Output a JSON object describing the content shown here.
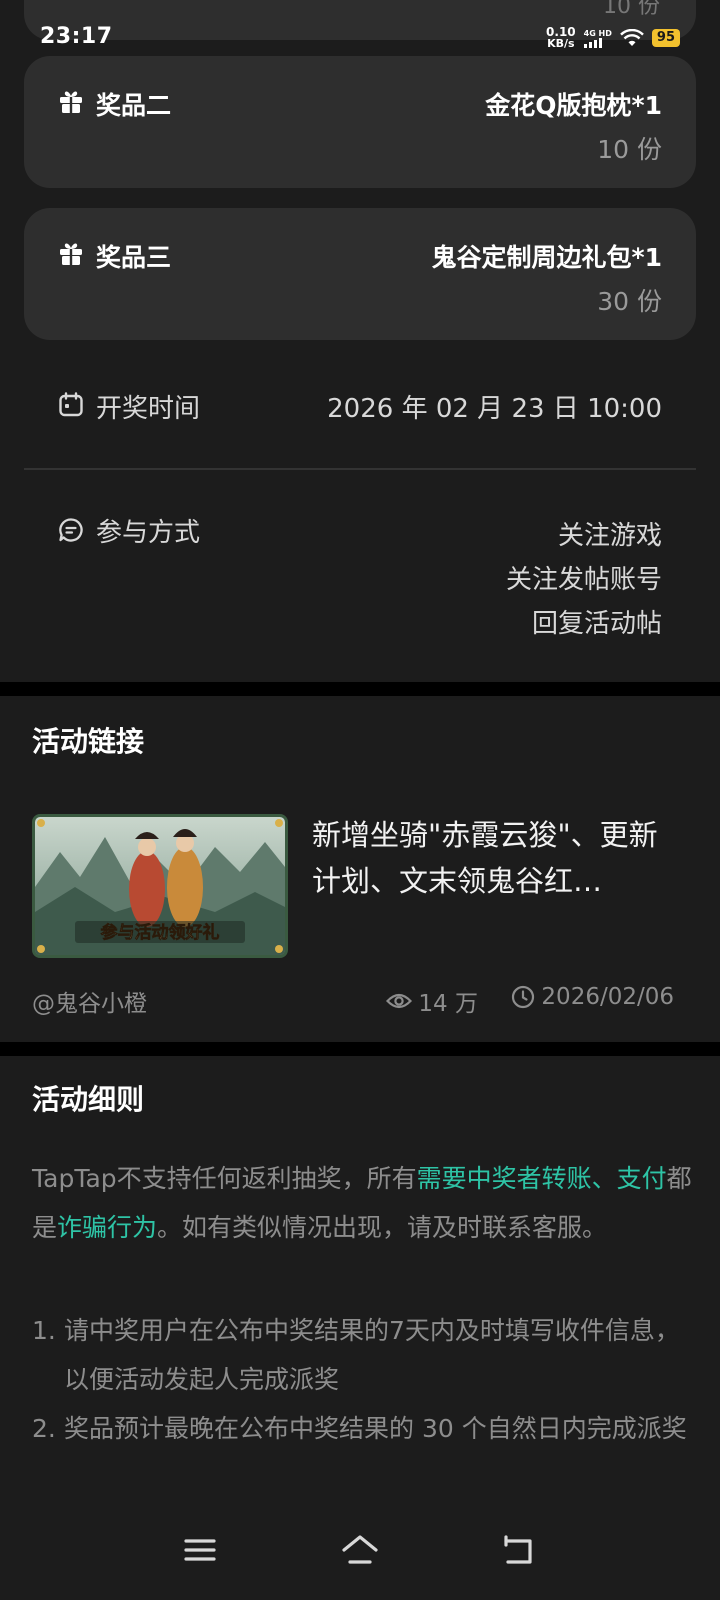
{
  "status_bar": {
    "time": "23:17",
    "net_speed_value": "0.10",
    "net_speed_unit": "KB/s",
    "network_type": "4G HD",
    "battery": "95"
  },
  "previous_card_fragment": "10 份",
  "prizes": [
    {
      "label": "奖品二",
      "name": "金花Q版抱枕*1",
      "count": "10 份"
    },
    {
      "label": "奖品三",
      "name": "鬼谷定制周边礼包*1",
      "count": "30 份"
    }
  ],
  "draw_time": {
    "label": "开奖时间",
    "value": "2026 年 02 月 23 日 10:00"
  },
  "participation": {
    "label": "参与方式",
    "methods": [
      "关注游戏",
      "关注发帖账号",
      "回复活动帖"
    ]
  },
  "activity_link": {
    "section_title": "活动链接",
    "thumbnail_caption": "参与活动领好礼",
    "title": "新增坐骑\"赤霞云狻\"、更新计划、文末领鬼谷红…",
    "author": "@鬼谷小橙",
    "views": "14 万",
    "date": "2026/02/06"
  },
  "rules": {
    "section_title": "活动细则",
    "intro_before": "TapTap不支持任何返利抽奖，所有",
    "intro_hl1": "需要中奖者转账、支付",
    "intro_mid": "都是",
    "intro_hl2": "诈骗行为",
    "intro_after": "。如有类似情况出现，请及时联系客服。",
    "items": [
      {
        "num": "1.",
        "text": "请中奖用户在公布中奖结果的7天内及时填写收件信息，以便活动发起人完成派奖"
      },
      {
        "num": "2.",
        "text": "奖品预计最晚在公布中奖结果的 30 个自然日内完成派奖"
      }
    ]
  },
  "colors": {
    "accent": "#2ec4a6",
    "card": "#2e2e2e",
    "background": "#1c1c1c",
    "battery": "#f2c12e"
  },
  "nav_icons": [
    "menu-icon",
    "home-icon",
    "back-icon"
  ]
}
